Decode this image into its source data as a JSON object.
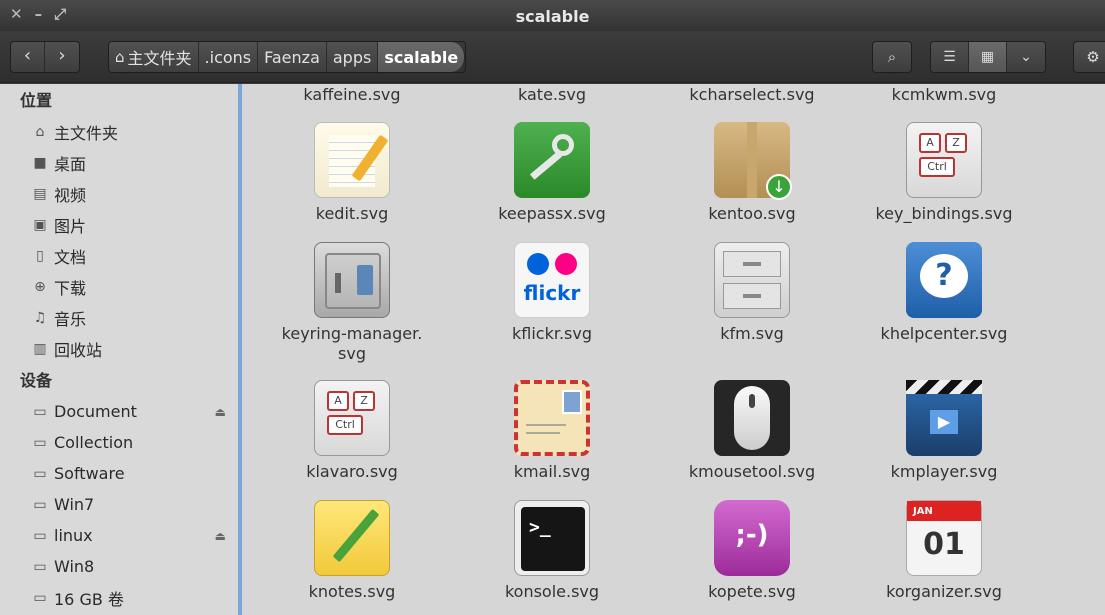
{
  "window": {
    "title": "scalable",
    "close": "✕",
    "minimize": "–",
    "maximize": "⤢"
  },
  "toolbar": {
    "back": "‹",
    "forward": "›",
    "breadcrumb": [
      {
        "label": "主文件夹",
        "icon": "home-icon"
      },
      {
        "label": ".icons"
      },
      {
        "label": "Faenza"
      },
      {
        "label": "apps"
      },
      {
        "label": "scalable"
      }
    ],
    "search_icon": "⌕",
    "view_list": "☰",
    "view_grid": "▦",
    "view_menu": "⌄",
    "settings": "⚙"
  },
  "sidebar": {
    "places_header": "位置",
    "places": [
      {
        "label": "主文件夹",
        "icon": "home-icon",
        "glyph": "⌂"
      },
      {
        "label": "桌面",
        "icon": "desktop-icon",
        "glyph": "■"
      },
      {
        "label": "视频",
        "icon": "video-icon",
        "glyph": "▤"
      },
      {
        "label": "图片",
        "icon": "picture-icon",
        "glyph": "▣"
      },
      {
        "label": "文档",
        "icon": "document-icon",
        "glyph": "▯"
      },
      {
        "label": "下载",
        "icon": "download-icon",
        "glyph": "⊕"
      },
      {
        "label": "音乐",
        "icon": "music-icon",
        "glyph": "♫"
      },
      {
        "label": "回收站",
        "icon": "trash-icon",
        "glyph": "▥"
      }
    ],
    "devices_header": "设备",
    "devices": [
      {
        "label": "Document",
        "icon": "drive-icon",
        "glyph": "▭",
        "eject": "⏏"
      },
      {
        "label": "Collection",
        "icon": "drive-icon",
        "glyph": "▭"
      },
      {
        "label": "Software",
        "icon": "drive-icon",
        "glyph": "▭"
      },
      {
        "label": "Win7",
        "icon": "drive-icon",
        "glyph": "▭"
      },
      {
        "label": "linux",
        "icon": "drive-icon",
        "glyph": "▭",
        "eject": "⏏"
      },
      {
        "label": "Win8",
        "icon": "drive-icon",
        "glyph": "▭"
      },
      {
        "label": "16 GB 卷",
        "icon": "drive-icon",
        "glyph": "▭"
      }
    ]
  },
  "files": {
    "top_row": [
      "kaffeine.svg",
      "kate.svg",
      "kcharselect.svg",
      "kcmkwm.svg"
    ],
    "rows": [
      [
        {
          "name": "kedit.svg",
          "icon": "notepad-pencil-icon"
        },
        {
          "name": "keepassx.svg",
          "icon": "key-icon"
        },
        {
          "name": "kentoo.svg",
          "icon": "package-box-icon"
        },
        {
          "name": "key_bindings.svg",
          "icon": "keyboard-keys-icon"
        }
      ],
      [
        {
          "name": "keyring-manager.\nsvg",
          "icon": "safe-icon"
        },
        {
          "name": "kflickr.svg",
          "icon": "flickr-icon",
          "text": "flickr"
        },
        {
          "name": "kfm.svg",
          "icon": "file-cabinet-icon"
        },
        {
          "name": "khelpcenter.svg",
          "icon": "help-icon",
          "text": "?"
        }
      ],
      [
        {
          "name": "klavaro.svg",
          "icon": "keyboard-keys-icon"
        },
        {
          "name": "kmail.svg",
          "icon": "envelope-icon"
        },
        {
          "name": "kmousetool.svg",
          "icon": "mouse-icon"
        },
        {
          "name": "kmplayer.svg",
          "icon": "clapperboard-icon"
        }
      ],
      [
        {
          "name": "knotes.svg",
          "icon": "sticky-note-icon"
        },
        {
          "name": "konsole.svg",
          "icon": "terminal-icon",
          "text": ">_"
        },
        {
          "name": "kopete.svg",
          "icon": "chat-bubble-icon",
          "text": ";-)"
        },
        {
          "name": "korganizer.svg",
          "icon": "calendar-icon",
          "month": "JAN",
          "day": "01"
        }
      ]
    ],
    "key_labels": {
      "a": "A",
      "z": "Z",
      "ctrl": "Ctrl"
    }
  },
  "colors": {
    "sidebar_accent": "#7aa6d8",
    "background": "#d6d6d6"
  }
}
